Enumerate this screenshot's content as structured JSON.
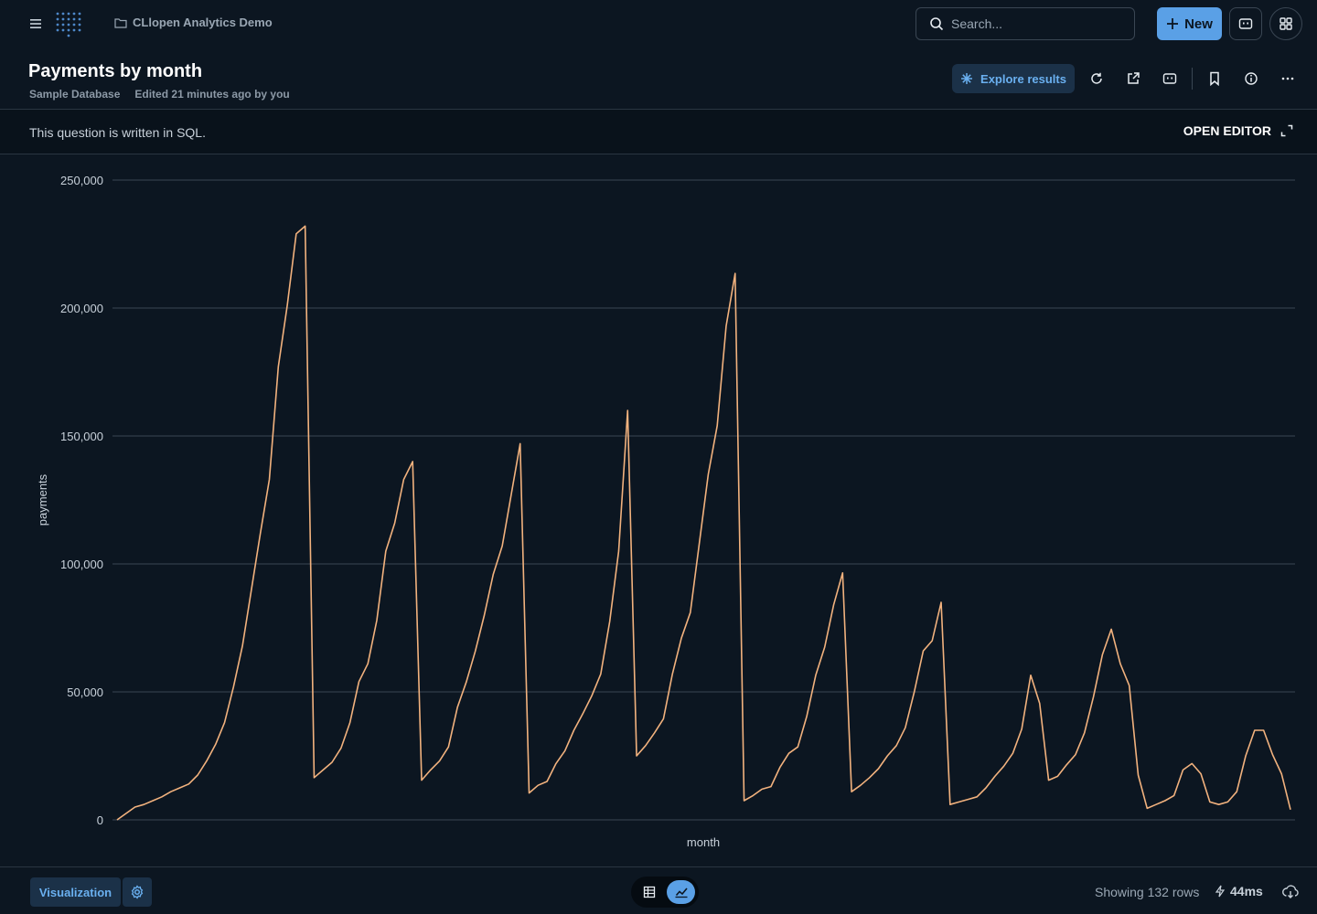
{
  "nav": {
    "collection": "CLlopen Analytics Demo",
    "search_placeholder": "Search...",
    "new_label": "New"
  },
  "header": {
    "title": "Payments by month",
    "database": "Sample Database",
    "edited": "Edited 21 minutes ago by you",
    "explore_label": "Explore results"
  },
  "sqlbar": {
    "message": "This question is written in SQL.",
    "open_editor": "OPEN EDITOR"
  },
  "footer": {
    "visualization_label": "Visualization",
    "rows": "Showing 132 rows",
    "timing": "44ms"
  },
  "colors": {
    "line": "#f2b27e",
    "accent": "#5aa0e6",
    "grid": "#3a4653",
    "background": "#0c1621"
  },
  "chart_data": {
    "type": "line",
    "xlabel": "month",
    "ylabel": "payments",
    "ylim": [
      0,
      250000
    ],
    "yticks": [
      "0",
      "50,000",
      "100,000",
      "150,000",
      "200,000",
      "250,000"
    ],
    "grid": true,
    "series": [
      {
        "values": [
          0,
          2500,
          5000,
          6000,
          7500,
          9000,
          11000,
          12500,
          14000,
          17500,
          23000,
          29500,
          38000,
          52000,
          68000,
          90000,
          112000,
          133000,
          177000,
          201000,
          229000,
          232000,
          16500,
          19500,
          22500,
          28000,
          38000,
          54000,
          61000,
          78000,
          105000,
          116000,
          133000,
          140000,
          15500,
          19500,
          23000,
          28500,
          44000,
          54000,
          66000,
          80000,
          96000,
          107000,
          127000,
          147000,
          10500,
          13500,
          15000,
          22000,
          27000,
          35000,
          41500,
          48500,
          57000,
          77500,
          105000,
          160000,
          25000,
          29000,
          34000,
          39500,
          57000,
          71000,
          81000,
          108000,
          135000,
          154000,
          193000,
          213500,
          7500,
          9500,
          12000,
          13000,
          20500,
          26000,
          28500,
          40500,
          56500,
          67500,
          84000,
          96500,
          11000,
          13500,
          16500,
          20000,
          25000,
          29000,
          36000,
          50000,
          66000,
          70000,
          85000,
          6000,
          7000,
          8000,
          9000,
          12500,
          17000,
          21000,
          26000,
          35500,
          56500,
          45500,
          15500,
          17000,
          21500,
          25500,
          34000,
          48000,
          64500,
          74500,
          61000,
          52500,
          17500,
          4500,
          6000,
          7500,
          9500,
          19500,
          22000,
          18000,
          7000,
          6000,
          7000,
          11000,
          25000,
          35000,
          35000,
          25500,
          18000,
          4000
        ]
      }
    ]
  }
}
